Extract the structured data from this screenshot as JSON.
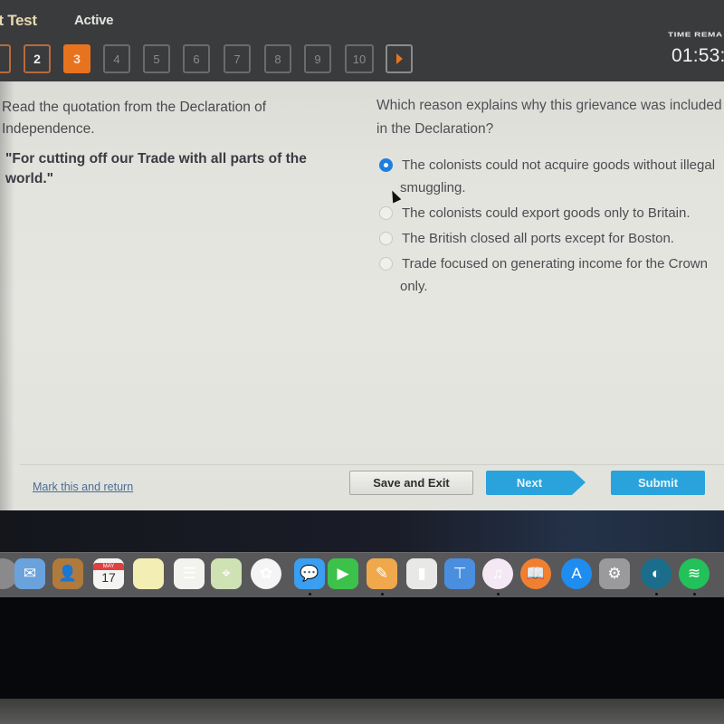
{
  "header": {
    "test_title": "it Test",
    "status": "Active",
    "question_nav": [
      {
        "label": "",
        "state": "done"
      },
      {
        "label": "2",
        "state": "done"
      },
      {
        "label": "3",
        "state": "current"
      },
      {
        "label": "4",
        "state": "unanswered"
      },
      {
        "label": "5",
        "state": "unanswered"
      },
      {
        "label": "6",
        "state": "unanswered"
      },
      {
        "label": "7",
        "state": "unanswered"
      },
      {
        "label": "8",
        "state": "unanswered"
      },
      {
        "label": "9",
        "state": "unanswered"
      },
      {
        "label": "10",
        "state": "unanswered"
      }
    ],
    "next_arrow_icon": "play-triangle-icon",
    "time_label": "TIME REMA",
    "time_value": "01:53:"
  },
  "passage": {
    "instruction": "Read the quotation from the Declaration of Independence.",
    "quote": "\"For cutting off our Trade with all parts of the world.\""
  },
  "question": {
    "prompt": "Which reason explains why this grievance was included in the Declaration?",
    "options": [
      {
        "text": "The colonists could not acquire goods without illegal",
        "cont": "smuggling.",
        "selected": true
      },
      {
        "text": "The colonists could export goods only to Britain.",
        "cont": "",
        "selected": false
      },
      {
        "text": "The British closed all ports except for Boston.",
        "cont": "",
        "selected": false
      },
      {
        "text": "Trade focused on generating income for the Crown",
        "cont": "only.",
        "selected": false
      }
    ]
  },
  "footer": {
    "mark_link": "Mark this and return",
    "save_exit": "Save and Exit",
    "next": "Next",
    "submit": "Submit"
  },
  "colors": {
    "accent_orange": "#e8731e",
    "button_blue": "#2aa3dc",
    "radio_selected": "#1e7fe0"
  },
  "dock": {
    "items": [
      {
        "name": "finder-icon",
        "glyph": "",
        "bg": "#8a8a8c",
        "running": false
      },
      {
        "name": "mail-icon",
        "glyph": "✉",
        "bg": "#6aa2dc",
        "running": false
      },
      {
        "name": "contacts-icon",
        "glyph": "👤",
        "bg": "#b07a3c",
        "running": false
      },
      {
        "name": "calendar-icon",
        "glyph": "17",
        "bg": "#f4f4f2",
        "running": false,
        "month": "MAY"
      },
      {
        "name": "notes-icon",
        "glyph": "",
        "bg": "#f3eeb4",
        "running": false
      },
      {
        "name": "reminders-icon",
        "glyph": "☰",
        "bg": "#f2f2ee",
        "running": false
      },
      {
        "name": "maps-icon",
        "glyph": "⌖",
        "bg": "#cfe2b4",
        "running": false
      },
      {
        "name": "photos-icon",
        "glyph": "✿",
        "bg": "#f4f4f4",
        "running": false
      },
      {
        "name": "messages-icon",
        "glyph": "💬",
        "bg": "#3a9ff0",
        "running": true
      },
      {
        "name": "facetime-icon",
        "glyph": "▶",
        "bg": "#3cc24a",
        "running": false
      },
      {
        "name": "pages-icon",
        "glyph": "✎",
        "bg": "#f0a84c",
        "running": true
      },
      {
        "name": "numbers-icon",
        "glyph": "▮",
        "bg": "#e8e8e6",
        "running": false
      },
      {
        "name": "keynote-icon",
        "glyph": "⊤",
        "bg": "#4a8ee0",
        "running": false
      },
      {
        "name": "itunes-icon",
        "glyph": "♫",
        "bg": "#f4e8f4",
        "running": true
      },
      {
        "name": "ibooks-icon",
        "glyph": "📖",
        "bg": "#f08030",
        "running": false
      },
      {
        "name": "app-store-icon",
        "glyph": "A",
        "bg": "#1f8cf0",
        "running": false
      },
      {
        "name": "system-preferences-icon",
        "glyph": "⚙",
        "bg": "#9a9a9c",
        "running": false
      },
      {
        "name": "webex-icon",
        "glyph": "◐",
        "bg": "#1a6e8c",
        "running": true
      },
      {
        "name": "spotify-icon",
        "glyph": "≋",
        "bg": "#22c15a",
        "running": true
      }
    ]
  }
}
